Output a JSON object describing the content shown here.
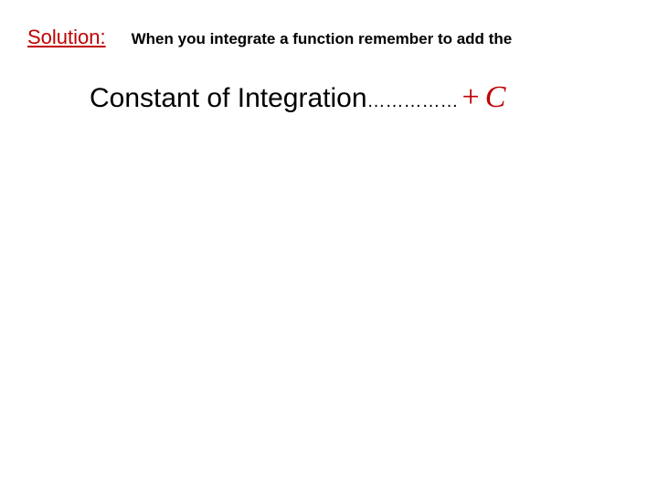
{
  "line1": {
    "solution_label": "Solution:",
    "intro_text": "When you integrate a function remember to add the"
  },
  "line2": {
    "constant_text": "Constant of Integration",
    "dots": "……………",
    "plus": "+",
    "C": "C"
  }
}
